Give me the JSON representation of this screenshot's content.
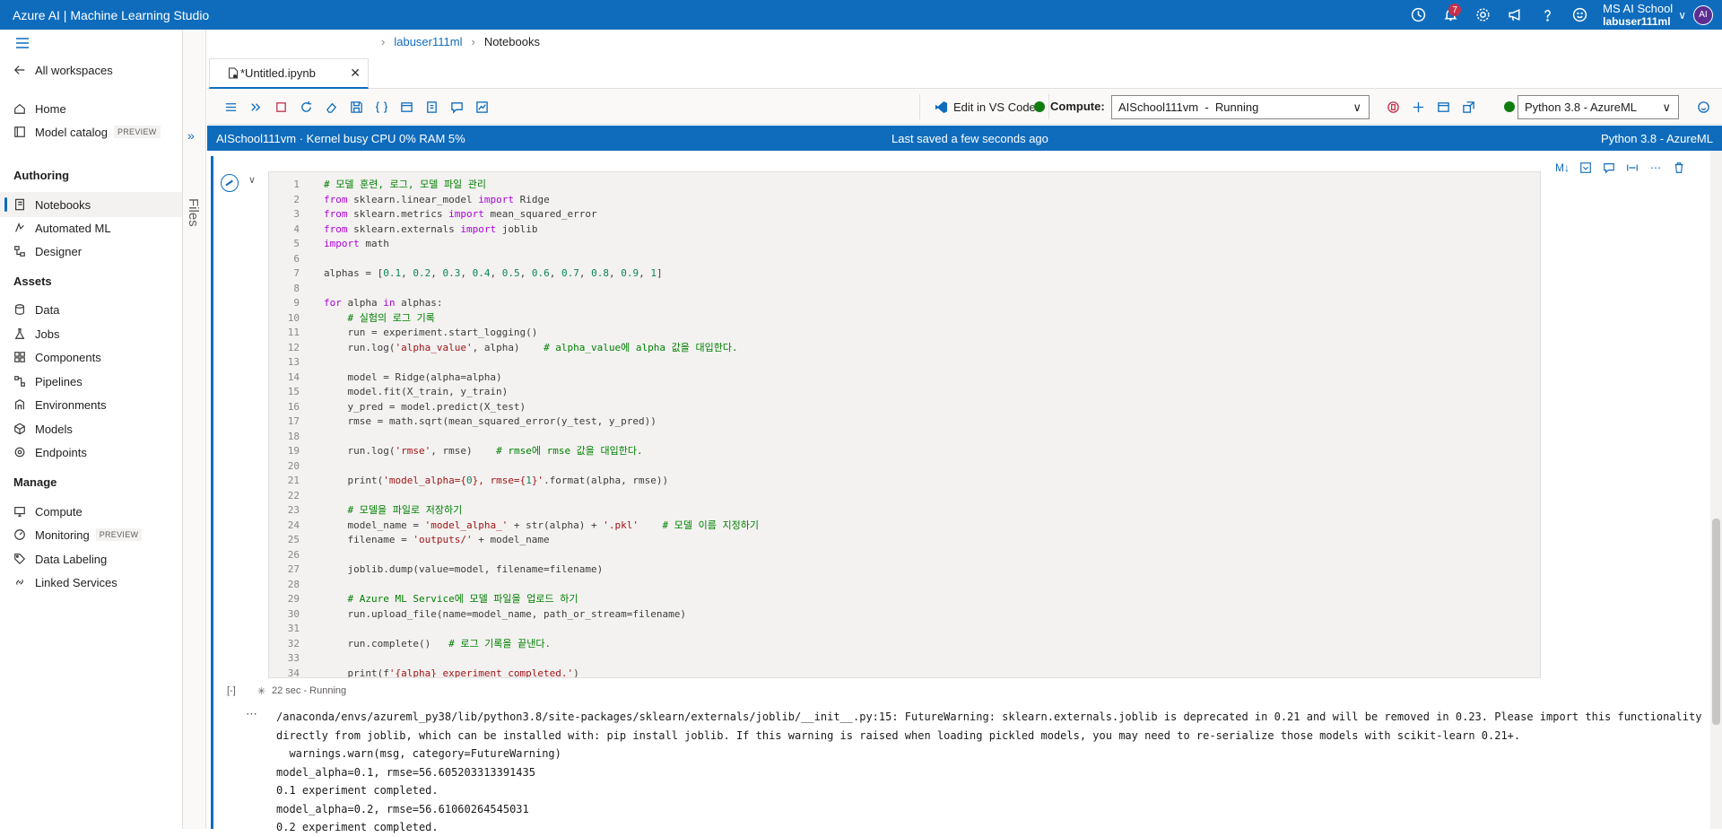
{
  "app": {
    "title": "Azure AI | Machine Learning Studio",
    "notification_count": "7",
    "user_org": "MS AI School",
    "user_name": "labuser111ml",
    "avatar_initials": "AI"
  },
  "sidebar": {
    "all_workspaces": "All workspaces",
    "home": "Home",
    "model_catalog": "Model catalog",
    "preview_badge": "PREVIEW",
    "section_authoring": "Authoring",
    "notebooks": "Notebooks",
    "automated_ml": "Automated ML",
    "designer": "Designer",
    "section_assets": "Assets",
    "data": "Data",
    "jobs": "Jobs",
    "components": "Components",
    "pipelines": "Pipelines",
    "environments": "Environments",
    "models": "Models",
    "endpoints": "Endpoints",
    "section_manage": "Manage",
    "compute": "Compute",
    "monitoring": "Monitoring",
    "data_labeling": "Data Labeling",
    "linked_services": "Linked Services"
  },
  "rail": {
    "files": "Files"
  },
  "breadcrumb": {
    "workspace": "labuser111ml",
    "page": "Notebooks"
  },
  "tab": {
    "name": "*Untitled.ipynb"
  },
  "toolbar": {
    "edit_vscode": "Edit in VS Code",
    "compute_label": "Compute:",
    "compute_value": "AISchool111vm  -  Running",
    "kernel_value": "Python 3.8 - AzureML"
  },
  "status": {
    "left": "AISchool111vm · Kernel busy  CPU  0%  RAM  5%",
    "center": "Last saved a few seconds ago",
    "right": "Python 3.8 - AzureML"
  },
  "cell": {
    "exec_bracket": "[-]",
    "exec_time": "22 sec - Running",
    "code_lines": [
      "# 모델 훈련, 로그, 모델 파일 관리",
      "from sklearn.linear_model import Ridge",
      "from sklearn.metrics import mean_squared_error",
      "from sklearn.externals import joblib",
      "import math",
      "",
      "alphas = [0.1, 0.2, 0.3, 0.4, 0.5, 0.6, 0.7, 0.8, 0.9, 1]",
      "",
      "for alpha in alphas:",
      "    # 실험의 로그 기록",
      "    run = experiment.start_logging()",
      "    run.log('alpha_value', alpha)    # alpha_value에 alpha 값을 대입한다.",
      "",
      "    model = Ridge(alpha=alpha)",
      "    model.fit(X_train, y_train)",
      "    y_pred = model.predict(X_test)",
      "    rmse = math.sqrt(mean_squared_error(y_test, y_pred))",
      "",
      "    run.log('rmse', rmse)    # rmse에 rmse 값을 대입한다.",
      "",
      "    print('model_alpha={0}, rmse={1}'.format(alpha, rmse))",
      "",
      "    # 모델을 파일로 저장하기",
      "    model_name = 'model_alpha_' + str(alpha) + '.pkl'    # 모델 이름 지정하기",
      "    filename = 'outputs/' + model_name",
      "",
      "    joblib.dump(value=model, filename=filename)",
      "",
      "    # Azure ML Service에 모델 파일을 업로드 하기",
      "    run.upload_file(name=model_name, path_or_stream=filename)",
      "",
      "    run.complete()   # 로그 기록을 끝낸다.",
      "",
      "    print(f'{alpha} experiment completed.')"
    ],
    "output_lines": [
      "/anaconda/envs/azureml_py38/lib/python3.8/site-packages/sklearn/externals/joblib/__init__.py:15: FutureWarning: sklearn.externals.joblib is deprecated in 0.21 and will be removed in 0.23. Please import this functionality",
      "directly from joblib, which can be installed with: pip install joblib. If this warning is raised when loading pickled models, you may need to re-serialize those models with scikit-learn 0.21+.",
      "  warnings.warn(msg, category=FutureWarning)",
      "model_alpha=0.1, rmse=56.605203313391435",
      "0.1 experiment completed.",
      "model_alpha=0.2, rmse=56.61060264545031",
      "0.2 experiment completed."
    ]
  },
  "colors": {
    "brand": "#0f6cbd",
    "running": "#107c10",
    "stop": "#c4314b"
  }
}
